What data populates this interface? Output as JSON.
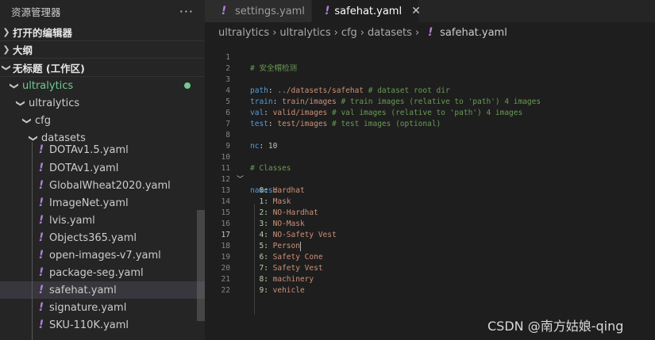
{
  "sidebar": {
    "title": "资源管理器",
    "more": "···",
    "sections": {
      "open_editors": "打开的编辑器",
      "outline": "大纲",
      "workspace": "无标题 (工作区)"
    },
    "tree": {
      "root": "ultralytics",
      "pkg": "ultralytics",
      "cfg": "cfg",
      "datasets": "datasets"
    },
    "files": [
      "DOTAv1.5.yaml",
      "DOTAv1.yaml",
      "GlobalWheat2020.yaml",
      "ImageNet.yaml",
      "lvis.yaml",
      "Objects365.yaml",
      "open-images-v7.yaml",
      "package-seg.yaml",
      "safehat.yaml",
      "signature.yaml",
      "SKU-110K.yaml"
    ]
  },
  "tabs": [
    {
      "label": "settings.yaml"
    },
    {
      "label": "safehat.yaml",
      "close": "✕"
    }
  ],
  "breadcrumb": [
    "ultralytics",
    "ultralytics",
    "cfg",
    "datasets",
    "safehat.yaml"
  ],
  "code": {
    "line_numbers": [
      "1",
      "2",
      "3",
      "4",
      "5",
      "6",
      "7",
      "8",
      "9",
      "10",
      "11",
      "12",
      "13",
      "14",
      "15",
      "16",
      "17",
      "18",
      "19",
      "20",
      "21",
      "22"
    ],
    "comment_title": "# 安全帽检测",
    "path_key": "path",
    "path_val": "../datasets/safehat",
    "path_cmt": "# dataset root dir",
    "train_key": "train",
    "train_val": "train/images",
    "train_cmt": "# train images (relative to 'path') 4 images",
    "val_key": "val",
    "val_val": "valid/images",
    "val_cmt": "# val images (relative to 'path') 4 images",
    "test_key": "test",
    "test_val": "test/images",
    "test_cmt": "# test images (optional)",
    "nc_key": "nc",
    "nc_val": "10",
    "classes_cmt": "# Classes",
    "names_key": "names",
    "names": [
      {
        "id": "0",
        "name": "Hardhat"
      },
      {
        "id": "1",
        "name": "Mask"
      },
      {
        "id": "2",
        "name": "NO-Hardhat"
      },
      {
        "id": "3",
        "name": "NO-Mask"
      },
      {
        "id": "4",
        "name": "NO-Safety Vest"
      },
      {
        "id": "5",
        "name": "Person"
      },
      {
        "id": "6",
        "name": "Safety Cone"
      },
      {
        "id": "7",
        "name": "Safety Vest"
      },
      {
        "id": "8",
        "name": "machinery"
      },
      {
        "id": "9",
        "name": "vehicle"
      }
    ]
  },
  "watermark": "CSDN @南方姑娘-qing",
  "colors": {
    "accent_green": "#73c991",
    "yaml_icon": "#b180d7",
    "comment": "#6a9955",
    "key": "#569cd6",
    "string": "#ce9178",
    "number": "#b5cea8"
  }
}
